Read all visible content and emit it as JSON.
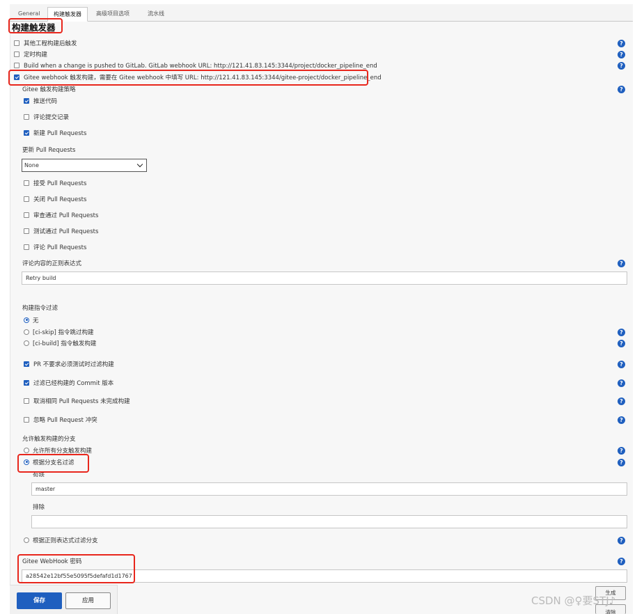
{
  "tabs": [
    "General",
    "构建触发器",
    "高级项目选项",
    "流水线"
  ],
  "section_title": "构建触发器",
  "triggers": [
    {
      "label": "其他工程构建后触发",
      "checked": false
    },
    {
      "label": "定时构建",
      "checked": false
    },
    {
      "label": "Build when a change is pushed to GitLab. GitLab webhook URL: http://121.41.83.145:3344/project/docker_pipeline_end",
      "checked": false
    },
    {
      "label": "Gitee webhook 触发构建，需要在 Gitee webhook 中填写 URL: http://121.41.83.145:3344/gitee-project/docker_pipeline_end",
      "checked": true
    }
  ],
  "strategy": {
    "title": "Gitee 触发构建策略",
    "items": [
      {
        "label": "推送代码",
        "checked": true
      },
      {
        "label": "评论提交记录",
        "checked": false
      },
      {
        "label": "新建 Pull Requests",
        "checked": true
      }
    ]
  },
  "update_pr": {
    "label": "更新 Pull Requests",
    "value": "None"
  },
  "pr_actions": [
    {
      "label": "接受 Pull Requests",
      "checked": false
    },
    {
      "label": "关闭 Pull Requests",
      "checked": false
    },
    {
      "label": "审查通过 Pull Requests",
      "checked": false
    },
    {
      "label": "测试通过 Pull Requests",
      "checked": false
    },
    {
      "label": "评论 Pull Requests",
      "checked": false
    }
  ],
  "comment_regex": {
    "label": "评论内容的正则表达式",
    "value": "Retry build"
  },
  "ci_filter": {
    "title": "构建指令过滤",
    "options": [
      {
        "label": "无",
        "selected": true
      },
      {
        "label": "[ci-skip] 指令跳过构建",
        "selected": false
      },
      {
        "label": "[ci-build] 指令触发构建",
        "selected": false
      }
    ]
  },
  "pr_options": [
    {
      "label": "PR 不要求必须测试时过滤构建",
      "checked": true
    },
    {
      "label": "过滤已经构建的 Commit 版本",
      "checked": true
    },
    {
      "label": "取消相同 Pull Requests 未完成构建",
      "checked": false
    },
    {
      "label": "忽略 Pull Request 冲突",
      "checked": false
    }
  ],
  "branches": {
    "title": "允许触发构建的分支",
    "opt_all": "允许所有分支触发构建",
    "opt_name": "根据分支名过滤",
    "include_label": "包括",
    "include_value": "master",
    "exclude_label": "排除",
    "exclude_value": "",
    "opt_regex": "根据正则表达式过滤分支"
  },
  "webhook_secret": {
    "label": "Gitee WebHook 密码",
    "value": "a28542e12bf55e5095f5defafd1d1767"
  },
  "buttons": {
    "save": "保存",
    "apply": "应用",
    "generate": "生成",
    "clear": "清除"
  },
  "watermark": "CSDN @♀要STJ♪",
  "help_glyph": "?",
  "colors": {
    "accent": "#1f5fbf",
    "highlight": "#e8261c"
  }
}
